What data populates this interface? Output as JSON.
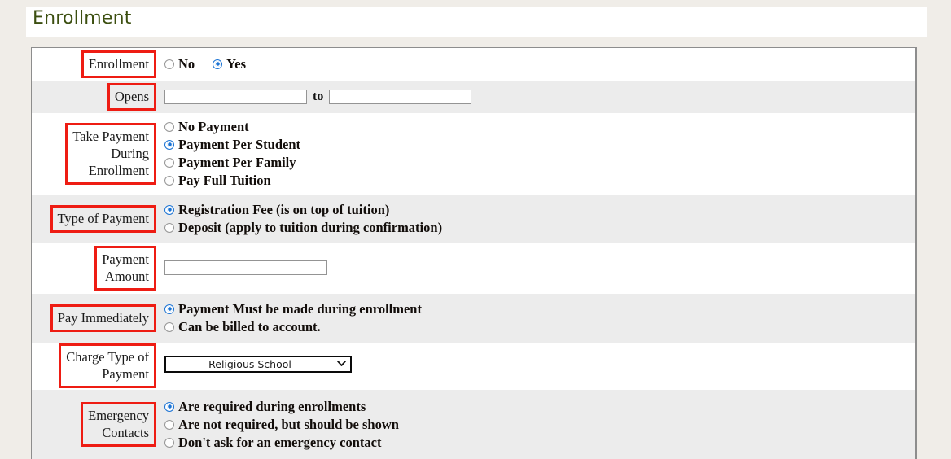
{
  "header": {
    "title": "Enrollment",
    "title_color": "#3c4f10"
  },
  "colors": {
    "page_background": "#f0ede8",
    "row_white": "#ffffff",
    "row_gray": "#ececec",
    "annotation_red": "#ee1c13",
    "radio_selected": "#1a73d4"
  },
  "form": {
    "rows": [
      {
        "label": "Enrollment",
        "type": "radio-inline",
        "options": [
          {
            "label": "No",
            "selected": false
          },
          {
            "label": "Yes",
            "selected": true
          }
        ]
      },
      {
        "label": "Opens",
        "type": "date-range",
        "from_value": "",
        "from_placeholder": "",
        "separator": "to",
        "to_value": "",
        "to_placeholder": ""
      },
      {
        "label": "Take Payment During Enrollment",
        "label_lines": [
          "Take Payment",
          "During",
          "Enrollment"
        ],
        "type": "radio-list",
        "options": [
          {
            "label": "No Payment",
            "selected": false
          },
          {
            "label": "Payment Per Student",
            "selected": true
          },
          {
            "label": "Payment Per Family",
            "selected": false
          },
          {
            "label": "Pay Full Tuition",
            "selected": false
          }
        ]
      },
      {
        "label": "Type of Payment",
        "label_lines": [
          "Type of Payment"
        ],
        "type": "radio-list",
        "options": [
          {
            "label": "Registration Fee (is on top of tuition)",
            "selected": true
          },
          {
            "label": "Deposit (apply to tuition during confirmation)",
            "selected": false
          }
        ]
      },
      {
        "label": "Payment Amount",
        "label_lines": [
          "Payment",
          "Amount"
        ],
        "type": "text",
        "value": "",
        "placeholder": ""
      },
      {
        "label": "Pay Immediately",
        "label_lines": [
          "Pay Immediately"
        ],
        "type": "radio-list",
        "options": [
          {
            "label": "Payment Must be made during enrollment",
            "selected": true
          },
          {
            "label": "Can be billed to account.",
            "selected": false
          }
        ]
      },
      {
        "label": "Charge Type of Payment",
        "label_lines": [
          "Charge Type of",
          "Payment"
        ],
        "type": "select",
        "selected_option": "Religious School",
        "options": [
          "Religious School"
        ]
      },
      {
        "label": "Emergency Contacts",
        "label_lines": [
          "Emergency",
          "Contacts"
        ],
        "type": "radio-list",
        "options": [
          {
            "label": "Are required during enrollments",
            "selected": true
          },
          {
            "label": "Are not required, but should be shown",
            "selected": false
          },
          {
            "label": "Don't ask for an emergency contact",
            "selected": false
          }
        ]
      }
    ]
  },
  "icons": {
    "chevron_down": "chevron-down-icon"
  }
}
